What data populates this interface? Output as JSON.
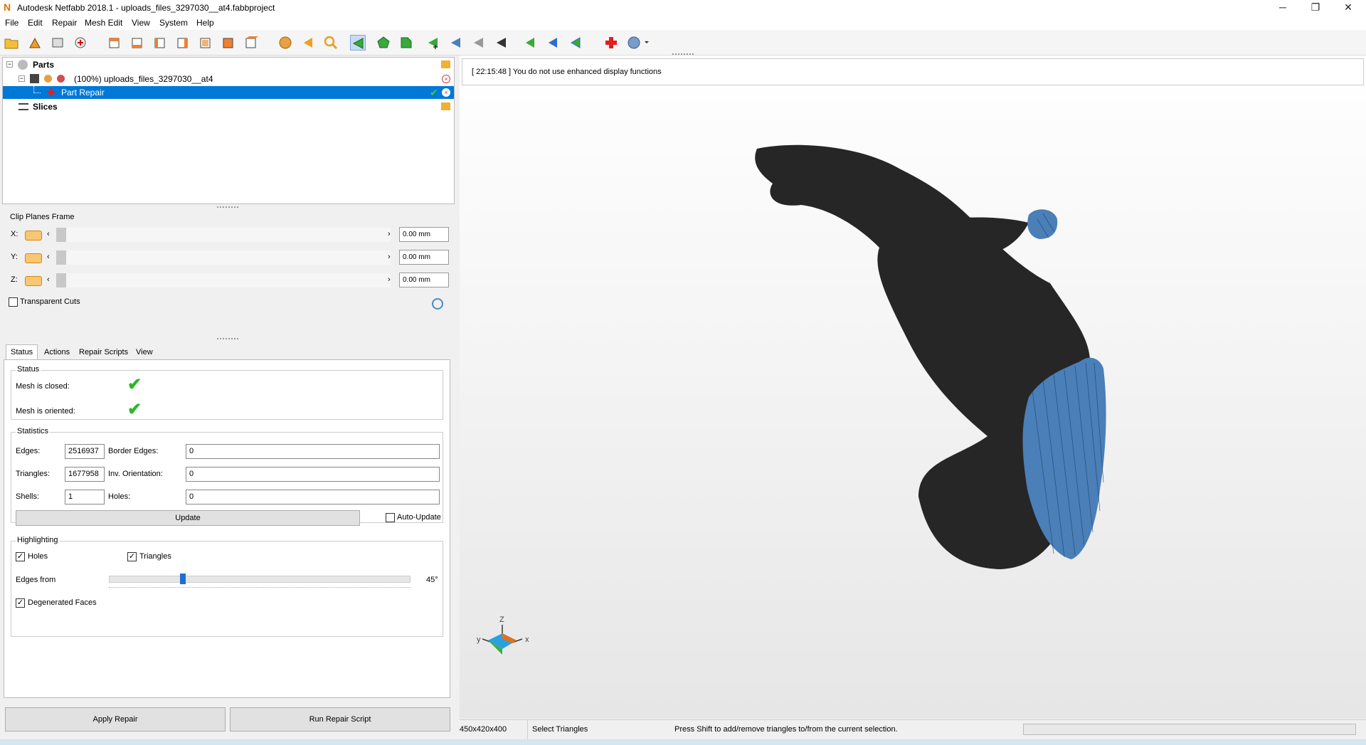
{
  "window": {
    "title": "Autodesk Netfabb 2018.1 - uploads_files_3297030__at4.fabbproject",
    "minimize": "─",
    "restore": "❐",
    "close": "✕"
  },
  "menu": [
    "File",
    "Edit",
    "Repair",
    "Mesh Edit",
    "View",
    "System",
    "Help"
  ],
  "tree": {
    "parts_label": "Parts",
    "part_name": "(100%) uploads_files_3297030__at4",
    "repair_label": "Part Repair",
    "slices_label": "Slices"
  },
  "clip_planes": {
    "title": "Clip Planes Frame",
    "rows": [
      {
        "axis": "X:",
        "value": "0.00 mm"
      },
      {
        "axis": "Y:",
        "value": "0.00 mm"
      },
      {
        "axis": "Z:",
        "value": "0.00 mm"
      }
    ],
    "transparent_cuts": "Transparent Cuts",
    "transparent_checked": false
  },
  "tabs": [
    "Status",
    "Actions",
    "Repair Scripts",
    "View"
  ],
  "status": {
    "group_title": "Status",
    "mesh_closed": "Mesh is closed:",
    "mesh_oriented": "Mesh is oriented:"
  },
  "statistics": {
    "group_title": "Statistics",
    "edges_label": "Edges:",
    "edges": "2516937",
    "border_edges_label": "Border Edges:",
    "border_edges": "0",
    "triangles_label": "Triangles:",
    "triangles": "1677958",
    "inv_orientation_label": "Inv. Orientation:",
    "inv_orientation": "0",
    "shells_label": "Shells:",
    "shells": "1",
    "holes_label": "Holes:",
    "holes": "0",
    "update_button": "Update",
    "auto_update": "Auto-Update"
  },
  "highlighting": {
    "group_title": "Highlighting",
    "holes": "Holes",
    "triangles": "Triangles",
    "edges_from": "Edges from",
    "edges_angle": "45°",
    "edges_angle_value": 45,
    "degenerated_faces": "Degenerated Faces"
  },
  "buttons": {
    "apply_repair": "Apply Repair",
    "run_repair_script": "Run Repair Script"
  },
  "viewport": {
    "message": "[ 22:15:48 ] You do not use enhanced display functions",
    "axis_z": "Z",
    "axis_y": "y",
    "axis_x": "x"
  },
  "statusbar": {
    "dimensions": "450x420x400",
    "mode": "Select Triangles",
    "hint": "Press Shift to add/remove triangles to/from the current selection."
  },
  "colors": {
    "selection": "#0078d7",
    "mesh": "#262626",
    "selected_triangles": "#4a7fb8"
  }
}
